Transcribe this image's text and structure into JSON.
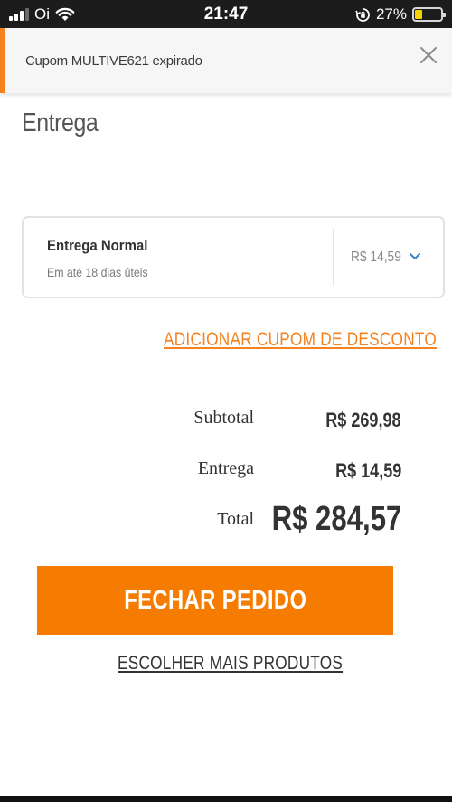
{
  "status_bar": {
    "carrier": "Oi",
    "time": "21:47",
    "battery_percent": "27%",
    "battery_level": 0.27,
    "icons": [
      "signal-icon",
      "wifi-icon",
      "rotation-lock-icon",
      "battery-icon"
    ]
  },
  "alert": {
    "message": "Cupom MULTIVE621 expirado",
    "accent_color": "#f5821f",
    "close_icon": "close-icon"
  },
  "page": {
    "title": "Entrega"
  },
  "shipping": {
    "name": "Entrega Normal",
    "eta": "Em até 18 dias úteis",
    "price": "R$ 14,59",
    "dropdown_icon": "chevron-down-icon"
  },
  "coupon": {
    "link_label": "ADICIONAR CUPOM DE DESCONTO"
  },
  "totals": {
    "subtotal_label": "Subtotal",
    "subtotal_value": "R$ 269,98",
    "delivery_label": "Entrega",
    "delivery_value": "R$ 14,59",
    "total_label": "Total",
    "total_value": "R$ 284,57"
  },
  "actions": {
    "checkout_label": "FECHAR PEDIDO",
    "checkout_color": "#f57c00",
    "more_products_label": "ESCOLHER MAIS PRODUTOS"
  }
}
